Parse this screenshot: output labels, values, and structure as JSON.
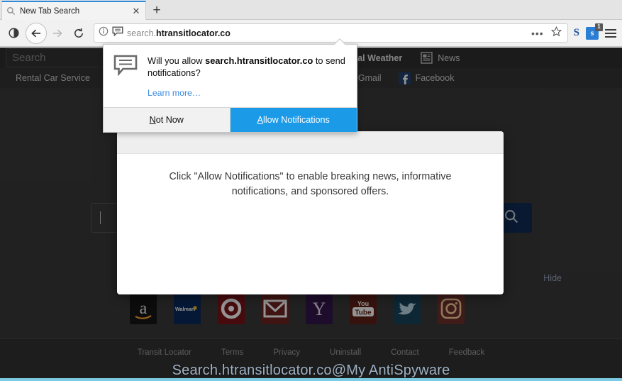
{
  "browser": {
    "tab": {
      "title": "New Tab Search",
      "favicon": "search-icon",
      "close_label": "✕"
    },
    "newtab_label": "+",
    "address": {
      "prefix": "search.",
      "domain": "htransitlocator.co"
    },
    "toolbar": {
      "reader_label": "◑",
      "back_label": "←",
      "forward_label": "→",
      "reload_label": "⟳",
      "page_actions_label": "•••",
      "bookmark_label": "☆"
    },
    "extensions": [
      {
        "name": "skype-letter-icon",
        "label": "S",
        "badge": ""
      },
      {
        "name": "skype-extension-icon",
        "label": "s",
        "badge": "1"
      }
    ],
    "menu_label": "hamburger-menu-icon"
  },
  "doorhanger": {
    "icon": "notification-bubble-icon",
    "question_prefix": "Will you allow ",
    "question_domain": "search.htransitlocator.co",
    "question_suffix": " to send notifications?",
    "learn_more": "Learn more…",
    "not_now": "Not Now",
    "not_now_accesskey": "N",
    "allow": "Allow Notifications",
    "allow_accesskey": "A"
  },
  "site_modal": {
    "message": "Click \"Allow Notifications\" to enable breaking news, informative notifications, and sponsored offers."
  },
  "page": {
    "search_placeholder": "Search",
    "header_links": [
      {
        "label": "Local Weather",
        "icon": "weather-icon",
        "bold": true
      },
      {
        "label": "News",
        "icon": "news-icon",
        "bold": false
      }
    ],
    "nav_links": [
      {
        "label": "Rental Car Service",
        "icon": ""
      },
      {
        "label": "Gmail",
        "icon": "gmail-icon"
      },
      {
        "label": "Facebook",
        "icon": "facebook-icon"
      }
    ],
    "hero": {
      "input_value": "",
      "search_button": "search-icon"
    },
    "hide_label": "Hide",
    "shortcuts": [
      {
        "name": "amazon",
        "label": "a",
        "bg": "#1a1a1a",
        "fg": "#f0f0f0"
      },
      {
        "name": "walmart",
        "label": "Walmart",
        "bg": "#0b2f63",
        "fg": "#ffffff"
      },
      {
        "name": "target",
        "label": "◎",
        "bg": "#7a1418",
        "fg": "#ffffff"
      },
      {
        "name": "gmail",
        "label": "M",
        "bg": "#6b2220",
        "fg": "#ffffff"
      },
      {
        "name": "yahoo",
        "label": "Y",
        "bg": "#2f1246",
        "fg": "#e8e0f0"
      },
      {
        "name": "youtube",
        "label": "Tube",
        "bg": "#5e1e16",
        "fg": "#ffffff"
      },
      {
        "name": "twitter",
        "label": "ᴡ",
        "bg": "#17445c",
        "fg": "#bcd9e8"
      },
      {
        "name": "instagram",
        "label": "◻",
        "bg": "#6b2f2a",
        "fg": "#f3c98b"
      }
    ],
    "footer_links": [
      "Transit Locator",
      "Terms",
      "Privacy",
      "Uninstall",
      "Contact",
      "Feedback"
    ]
  },
  "watermark": "Search.htransitlocator.co@My AntiSpyware",
  "colors": {
    "accent_blue": "#1b9ae8",
    "page_bg": "#3a3a3a",
    "header_bg": "#2f2f2f",
    "search_button": "#0f2b55",
    "watermark": "#9fb2c4"
  }
}
